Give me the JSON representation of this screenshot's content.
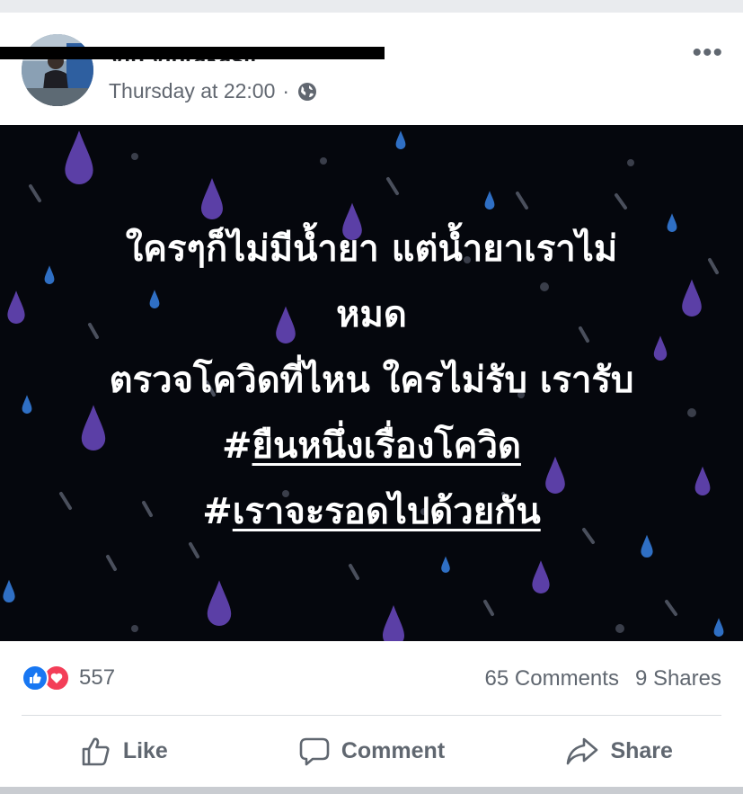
{
  "post": {
    "author": "Vip Viprakasit",
    "timestamp": "Thursday at 22:00",
    "separator": "·",
    "privacy_icon": "globe-icon",
    "more_label": "•••",
    "image_text": {
      "line1": "ใครๆก็ไม่มีน้ำยา แต่น้ำยาเราไม่",
      "line2": "หมด",
      "line3": "ตรวจโควิดที่ไหน ใครไม่รับ เรารับ",
      "hashtag1_prefix": "#",
      "hashtag1": "ยืนหนึ่งเรื่องโควิด",
      "hashtag2_prefix": "#",
      "hashtag2": "เราจะรอดไปด้วยกัน"
    }
  },
  "reactions": {
    "icons": [
      "like-reaction-icon",
      "love-reaction-icon"
    ],
    "count": "557",
    "comments": "65 Comments",
    "shares": "9 Shares"
  },
  "actions": {
    "like": "Like",
    "comment": "Comment",
    "share": "Share"
  },
  "colors": {
    "like_blue": "#1877f2",
    "love_red": "#f33e58",
    "text_gray": "#606770",
    "image_bg": "#05070d",
    "drop_purple": "#5b3fa6",
    "drop_blue": "#2f6fc4"
  }
}
